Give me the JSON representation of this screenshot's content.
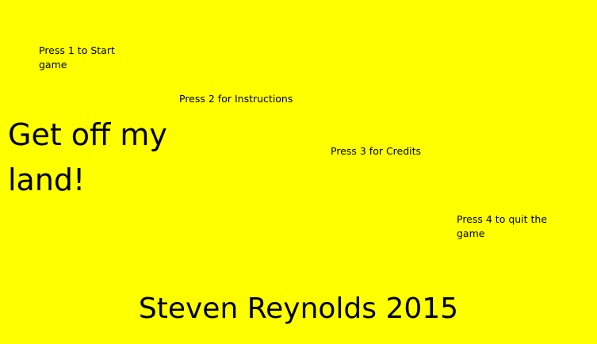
{
  "colors": {
    "background": "#ffff00",
    "text": "#000000"
  },
  "menu": {
    "option_start": "Press 1 to Start game",
    "option_instructions": "Press 2 for Instructions",
    "option_credits": "Press 3 for Credits",
    "option_quit": "Press 4 to quit the game"
  },
  "title": "Get off my land!",
  "footer": "Steven Reynolds 2015"
}
